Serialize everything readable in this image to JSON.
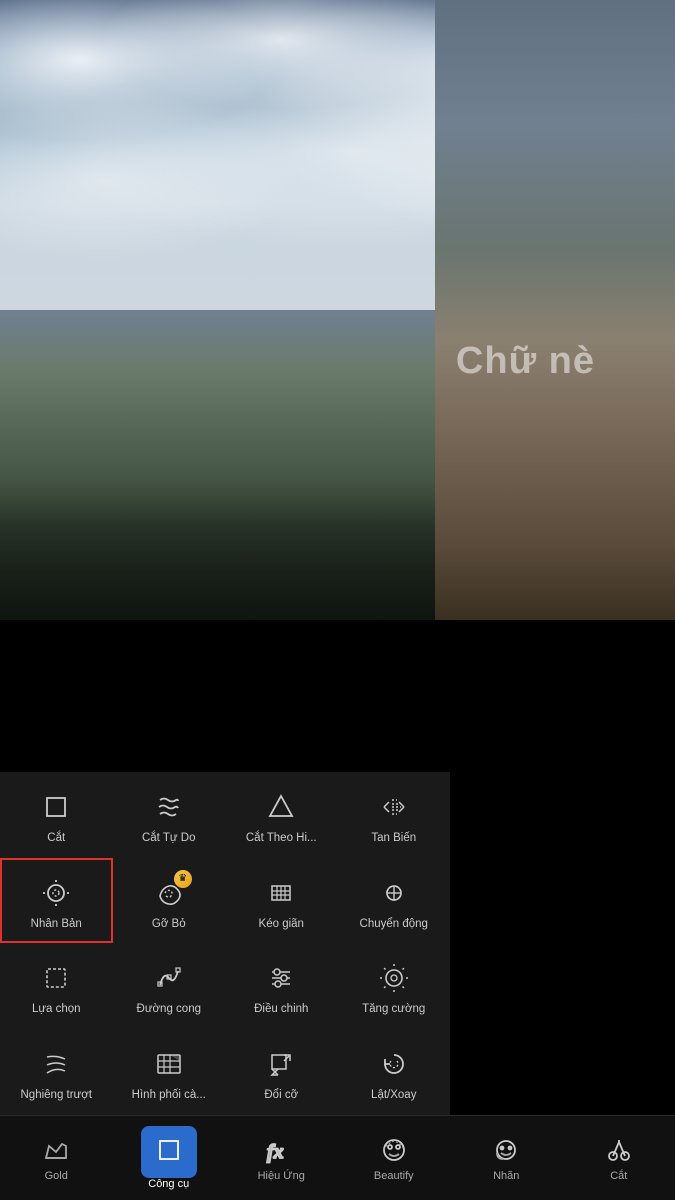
{
  "photo": {
    "watermark": "Chữ nè"
  },
  "tools": {
    "rows": [
      [
        {
          "id": "cat",
          "label": "Cắt",
          "icon": "crop"
        },
        {
          "id": "cat-tu-do",
          "label": "Cắt Tự Do",
          "icon": "freecut"
        },
        {
          "id": "cat-theo-hinh",
          "label": "Cắt Theo Hi...",
          "icon": "shapecut"
        },
        {
          "id": "tan-bien",
          "label": "Tan Biến",
          "icon": "dissolve"
        }
      ],
      [
        {
          "id": "nhan-ban",
          "label": "Nhân Bản",
          "icon": "clone",
          "active": true
        },
        {
          "id": "go-bo",
          "label": "Gỡ Bỏ",
          "icon": "remove",
          "gold": true
        },
        {
          "id": "keo-gian",
          "label": "Kéo giãn",
          "icon": "stretch"
        },
        {
          "id": "chuyen-dong",
          "label": "Chuyển động",
          "icon": "motion"
        }
      ],
      [
        {
          "id": "lua-chon",
          "label": "Lựa chọn",
          "icon": "select"
        },
        {
          "id": "duong-cong",
          "label": "Đường cong",
          "icon": "curve"
        },
        {
          "id": "dieu-chinh",
          "label": "Điều chinh",
          "icon": "adjust"
        },
        {
          "id": "tang-cuong",
          "label": "Tăng cường",
          "icon": "enhance"
        }
      ],
      [
        {
          "id": "nghieng-truot",
          "label": "Nghiêng trượt",
          "icon": "tilt"
        },
        {
          "id": "hinh-phoi-ca",
          "label": "Hình phối cà...",
          "icon": "blend"
        },
        {
          "id": "doi-co",
          "label": "Đổi cỡ",
          "icon": "resize"
        },
        {
          "id": "lat-xoay",
          "label": "Lật/Xoay",
          "icon": "rotate"
        }
      ]
    ]
  },
  "nav": {
    "items": [
      {
        "id": "gold",
        "label": "Gold",
        "icon": "crown"
      },
      {
        "id": "cong-cu",
        "label": "Công cụ",
        "icon": "crop-nav",
        "active": true
      },
      {
        "id": "hieu-ung",
        "label": "Hiệu Ứng",
        "icon": "fx"
      },
      {
        "id": "beautify",
        "label": "Beautify",
        "icon": "face"
      },
      {
        "id": "nhan",
        "label": "Nhãn",
        "icon": "sticker"
      },
      {
        "id": "cat-nav",
        "label": "Cắt",
        "icon": "cut"
      }
    ]
  }
}
